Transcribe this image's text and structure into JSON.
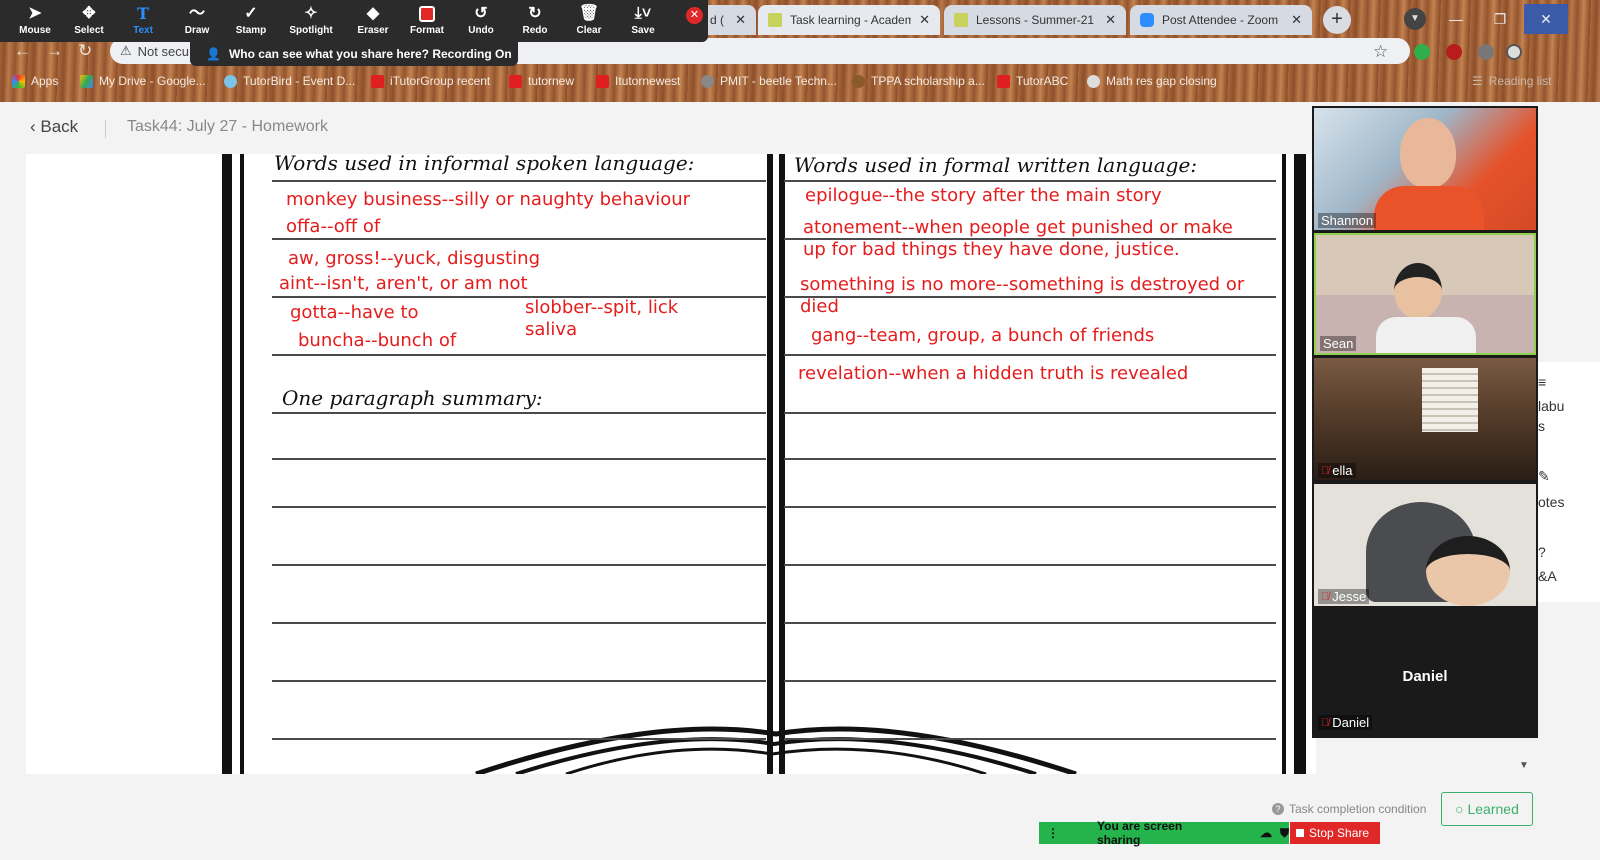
{
  "browser": {
    "tabs": [
      {
        "label": "d (",
        "icon": "doc-icon"
      },
      {
        "label": "Task learning - Academ",
        "icon": "tutor-icon"
      },
      {
        "label": "Lessons - Summer-21 -",
        "icon": "tutor-icon"
      },
      {
        "label": "Post Attendee - Zoom",
        "icon": "zoom-icon"
      }
    ],
    "address": "Not secu",
    "bookmarks": [
      "Apps",
      "My Drive - Google...",
      "TutorBird - Event D...",
      "iTutorGroup recent",
      "tutornew",
      "Itutornewest",
      "PMIT - beetle Techn...",
      "TPPA scholarship a...",
      "TutorABC",
      "Math res gap closing"
    ],
    "reading_list": "Reading list"
  },
  "zoom_toolbar": {
    "tools": [
      "Mouse",
      "Select",
      "Text",
      "Draw",
      "Stamp",
      "Spotlight",
      "Eraser",
      "Format",
      "Undo",
      "Redo",
      "Clear",
      "Save"
    ],
    "active_tool": "Text",
    "recording_banner": "Who can see what you share here? Recording On"
  },
  "page": {
    "back_label": "Back",
    "breadcrumb": "Task44:  July 27 - Homework",
    "task_completion": "Task completion condition",
    "learned_label": "Learned"
  },
  "worksheet": {
    "left_heading": "Words used in informal spoken language:",
    "right_heading": "Words used in formal written language:",
    "summary_heading": "One paragraph summary:",
    "left_entries": [
      "monkey business--silly or naughty behaviour",
      "offa--off of",
      "aw, gross!--yuck, disgusting",
      "aint--isn't, aren't, or am not",
      "gotta--have to",
      "slobber--spit, lick",
      "saliva",
      "buncha--bunch of"
    ],
    "right_entries": [
      "epilogue--the story after the main story",
      "atonement--when people get punished or make",
      "up for bad things they have done, justice.",
      "something is no more--something is destroyed or",
      "died",
      "gang--team, group, a bunch of friends",
      "revelation--when a hidden truth is revealed"
    ]
  },
  "participants": [
    {
      "name": "Shannon",
      "muted": false
    },
    {
      "name": "Sean",
      "muted": false
    },
    {
      "name": "ella",
      "muted": true
    },
    {
      "name": "Jesse",
      "muted": true
    },
    {
      "name": "Daniel",
      "muted": true
    }
  ],
  "side_panel_cut": [
    "labu",
    "s",
    "otes",
    "&A"
  ],
  "share": {
    "status": "You are screen sharing",
    "stop_label": "Stop Share"
  },
  "colors": {
    "annotation_red": "#e51c1c",
    "zoom_blue": "#2d8cff",
    "learned_green": "#3bb06a",
    "share_green": "#25b34b",
    "stop_red": "#e02828"
  }
}
